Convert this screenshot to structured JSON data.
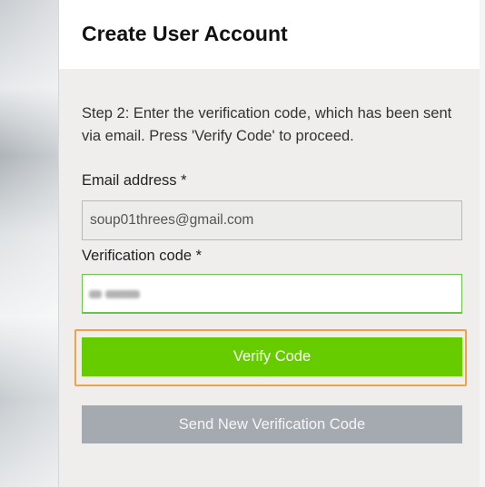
{
  "dialog": {
    "title": "Create User Account",
    "instructions": "Step 2: Enter the verification code, which has been sent via email. Press 'Verify Code' to proceed."
  },
  "form": {
    "email": {
      "label": "Email address *",
      "value": "soup01threes@gmail.com"
    },
    "verification_code": {
      "label": "Verification code *",
      "value_obscured": true
    }
  },
  "buttons": {
    "verify_label": "Verify Code",
    "resend_label": "Send New Verification Code"
  },
  "colors": {
    "primary_button": "#66cc00",
    "secondary_button": "#a5a9b0",
    "focus_outline": "#f0a249",
    "active_field_border": "#6cc24a",
    "panel_background": "#efeeed"
  }
}
